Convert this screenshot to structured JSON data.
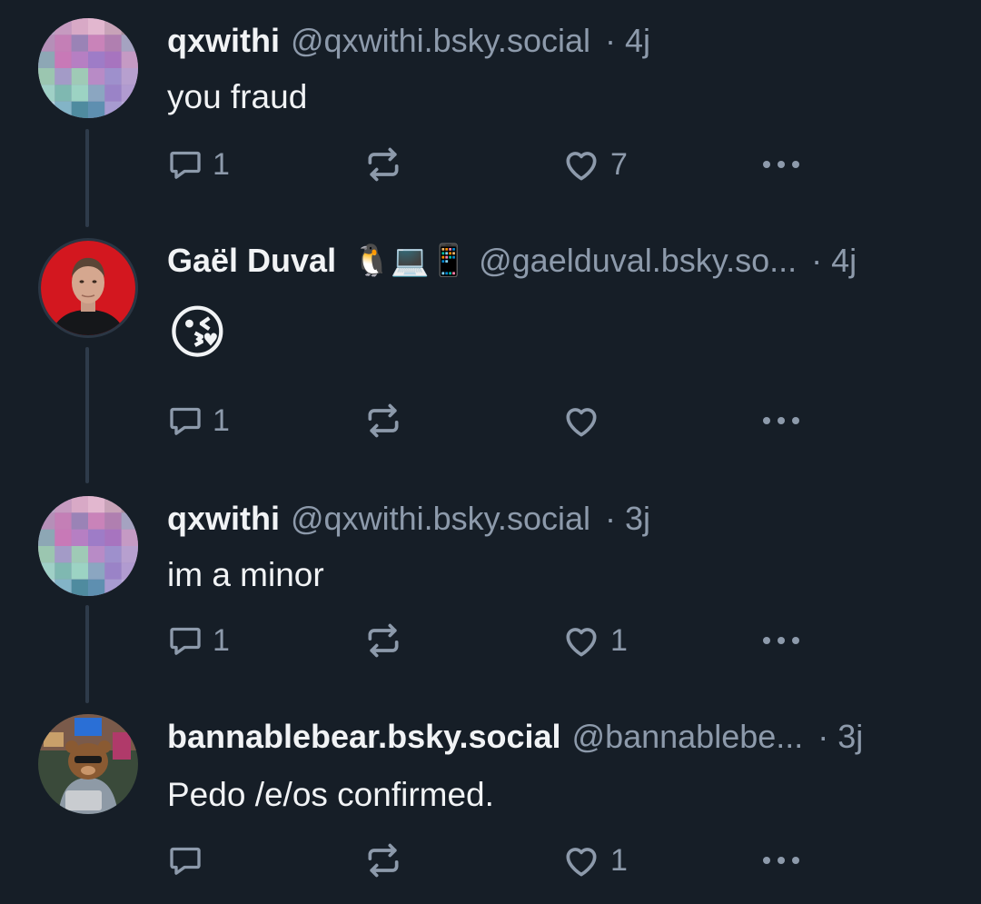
{
  "colors": {
    "background": "#161e27",
    "text": "#f1f3f5",
    "muted": "#8d9aab",
    "thread_line": "#2e3b4a"
  },
  "posts": [
    {
      "name": "qxwithi",
      "handle": "@qxwithi.bsky.social",
      "time": "· 4j",
      "text": "you fraud",
      "avatar": "pixelated-avatar",
      "replies": "1",
      "reposts": "",
      "likes": "7"
    },
    {
      "name": "Gaël Duval",
      "name_emojis": "🐧💻📱",
      "handle": "@gaelduval.bsky.so...",
      "time": "· 4j",
      "text": "😘",
      "avatar": "photo-avatar",
      "replies": "1",
      "reposts": "",
      "likes": ""
    },
    {
      "name": "qxwithi",
      "handle": "@qxwithi.bsky.social",
      "time": "· 3j",
      "text": "im a minor",
      "avatar": "pixelated-avatar",
      "replies": "1",
      "reposts": "",
      "likes": "1"
    },
    {
      "name": "bannablebear.bsky.social",
      "handle": "@bannablebe...",
      "time": "· 3j",
      "text": "Pedo /e/os confirmed.",
      "avatar": "bear-avatar",
      "replies": "",
      "reposts": "",
      "likes": "1"
    }
  ]
}
